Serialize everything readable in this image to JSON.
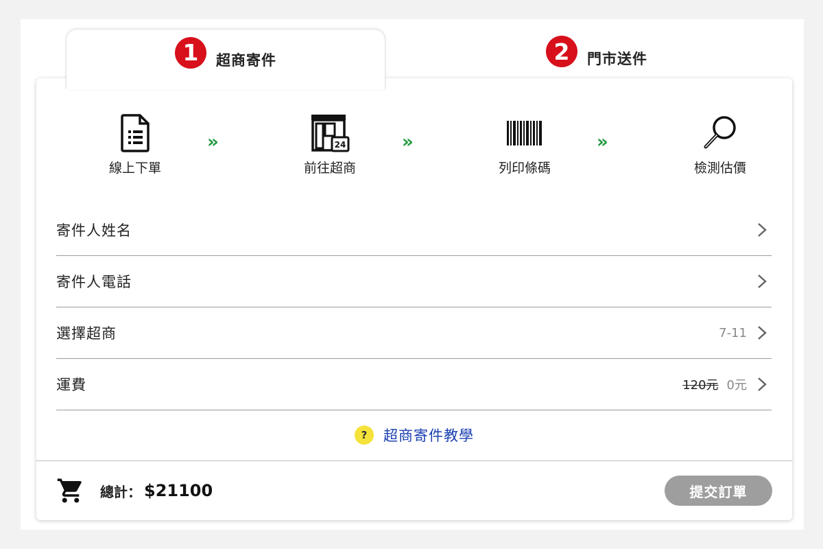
{
  "tabs": [
    {
      "number": "1",
      "label": "超商寄件",
      "active": true
    },
    {
      "number": "2",
      "label": "門市送件",
      "active": false
    }
  ],
  "steps": [
    {
      "label": "線上下單",
      "icon": "document-list-icon"
    },
    {
      "label": "前往超商",
      "icon": "convenience-store-24-icon"
    },
    {
      "label": "列印條碼",
      "icon": "barcode-icon"
    },
    {
      "label": "檢測估價",
      "icon": "magnifier-icon"
    }
  ],
  "step_arrow": "»",
  "form": {
    "rows": [
      {
        "label": "寄件人姓名",
        "value": ""
      },
      {
        "label": "寄件人電話",
        "value": ""
      },
      {
        "label": "選擇超商",
        "value": "7-11"
      },
      {
        "label": "運費",
        "original_price": "120元",
        "value": "0元"
      }
    ]
  },
  "help": {
    "icon": "?",
    "link_label": "超商寄件教學"
  },
  "footer": {
    "total_label": "總計：",
    "total_value": "$21100",
    "submit_label": "提交訂單"
  },
  "colors": {
    "badge": "#d7101b",
    "arrow": "#1f9a3e",
    "link": "#1a3fb0",
    "help_icon": "#f5e23a",
    "submit_button": "#9e9e9e"
  }
}
